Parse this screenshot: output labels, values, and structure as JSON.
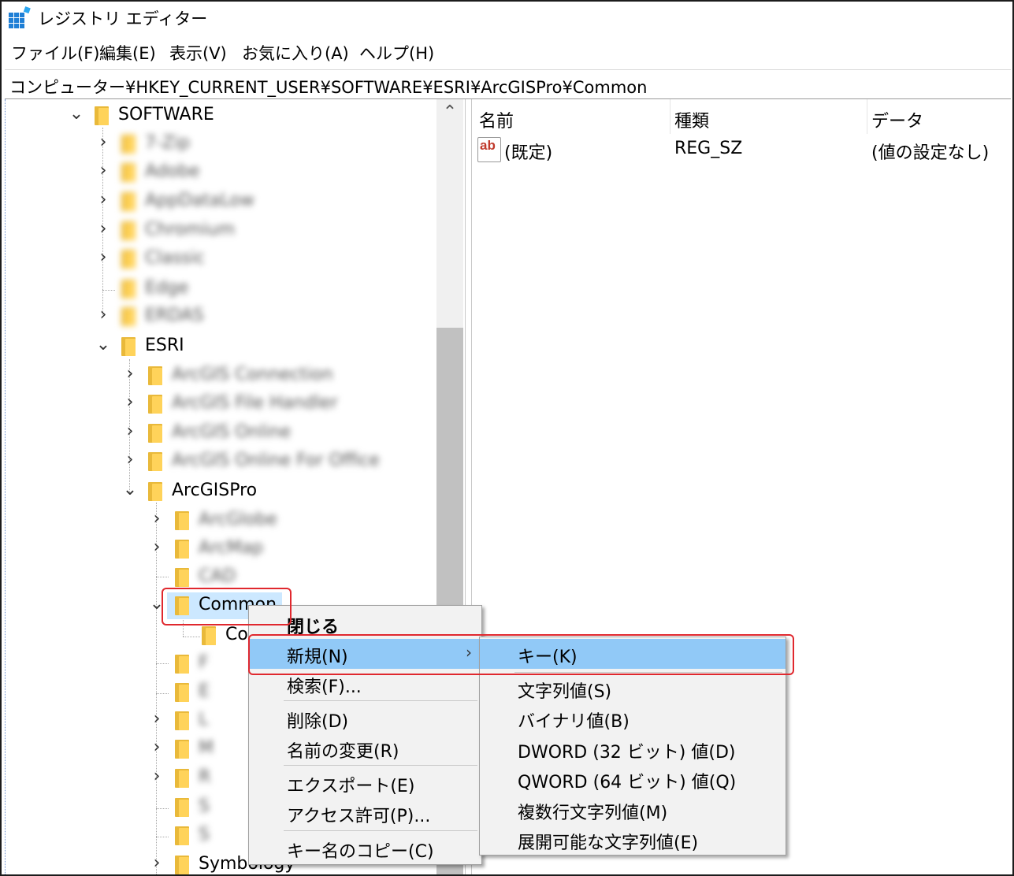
{
  "window": {
    "title": "レジストリ エディター"
  },
  "menubar": {
    "items": [
      "ファイル(F)",
      "編集(E)",
      "表示(V)",
      "お気に入り(A)",
      "ヘルプ(H)"
    ]
  },
  "address": {
    "path": "コンピューター¥HKEY_CURRENT_USER¥SOFTWARE¥ESRI¥ArcGISPro¥Common"
  },
  "tree": {
    "software": "SOFTWARE",
    "software_children_blurred": [
      "7-Zip",
      "Adobe",
      "AppDataLow",
      "Chromium",
      "Classic",
      "Edge",
      "ERDAS"
    ],
    "esri": "ESRI",
    "esri_children_blurred": [
      "ArcGIS Connection",
      "ArcGIS File Handler",
      "ArcGIS Online",
      "ArcGIS Online For Office"
    ],
    "arcgispro": "ArcGISPro",
    "arcgispro_children_blurred": [
      "ArcGlobe",
      "ArcMap",
      "CAD"
    ],
    "common": "Common",
    "common_child_partial": "Co",
    "more_blurred": [
      "F",
      "E",
      "L",
      "M",
      "R",
      "S",
      "S"
    ],
    "last_partial": "Symbology"
  },
  "list": {
    "columns": [
      "名前",
      "種類",
      "データ"
    ],
    "rows": [
      {
        "name": "(既定)",
        "type": "REG_SZ",
        "data": "(値の設定なし)",
        "icon": "string-value-icon"
      }
    ]
  },
  "context_menu": {
    "items": [
      "閉じる",
      "新規(N)",
      "検索(F)...",
      "削除(D)",
      "名前の変更(R)",
      "エクスポート(E)",
      "アクセス許可(P)...",
      "キー名のコピー(C)"
    ],
    "highlighted": "新規(N)"
  },
  "submenu": {
    "items": [
      "キー(K)",
      "文字列値(S)",
      "バイナリ値(B)",
      "DWORD (32 ビット) 値(D)",
      "QWORD (64 ビット) 値(Q)",
      "複数行文字列値(M)",
      "展開可能な文字列値(E)"
    ],
    "highlighted": "キー(K)"
  },
  "colors": {
    "highlight": "#91c9f7",
    "annotation": "#e0282e",
    "folder": "#ffd35a"
  }
}
